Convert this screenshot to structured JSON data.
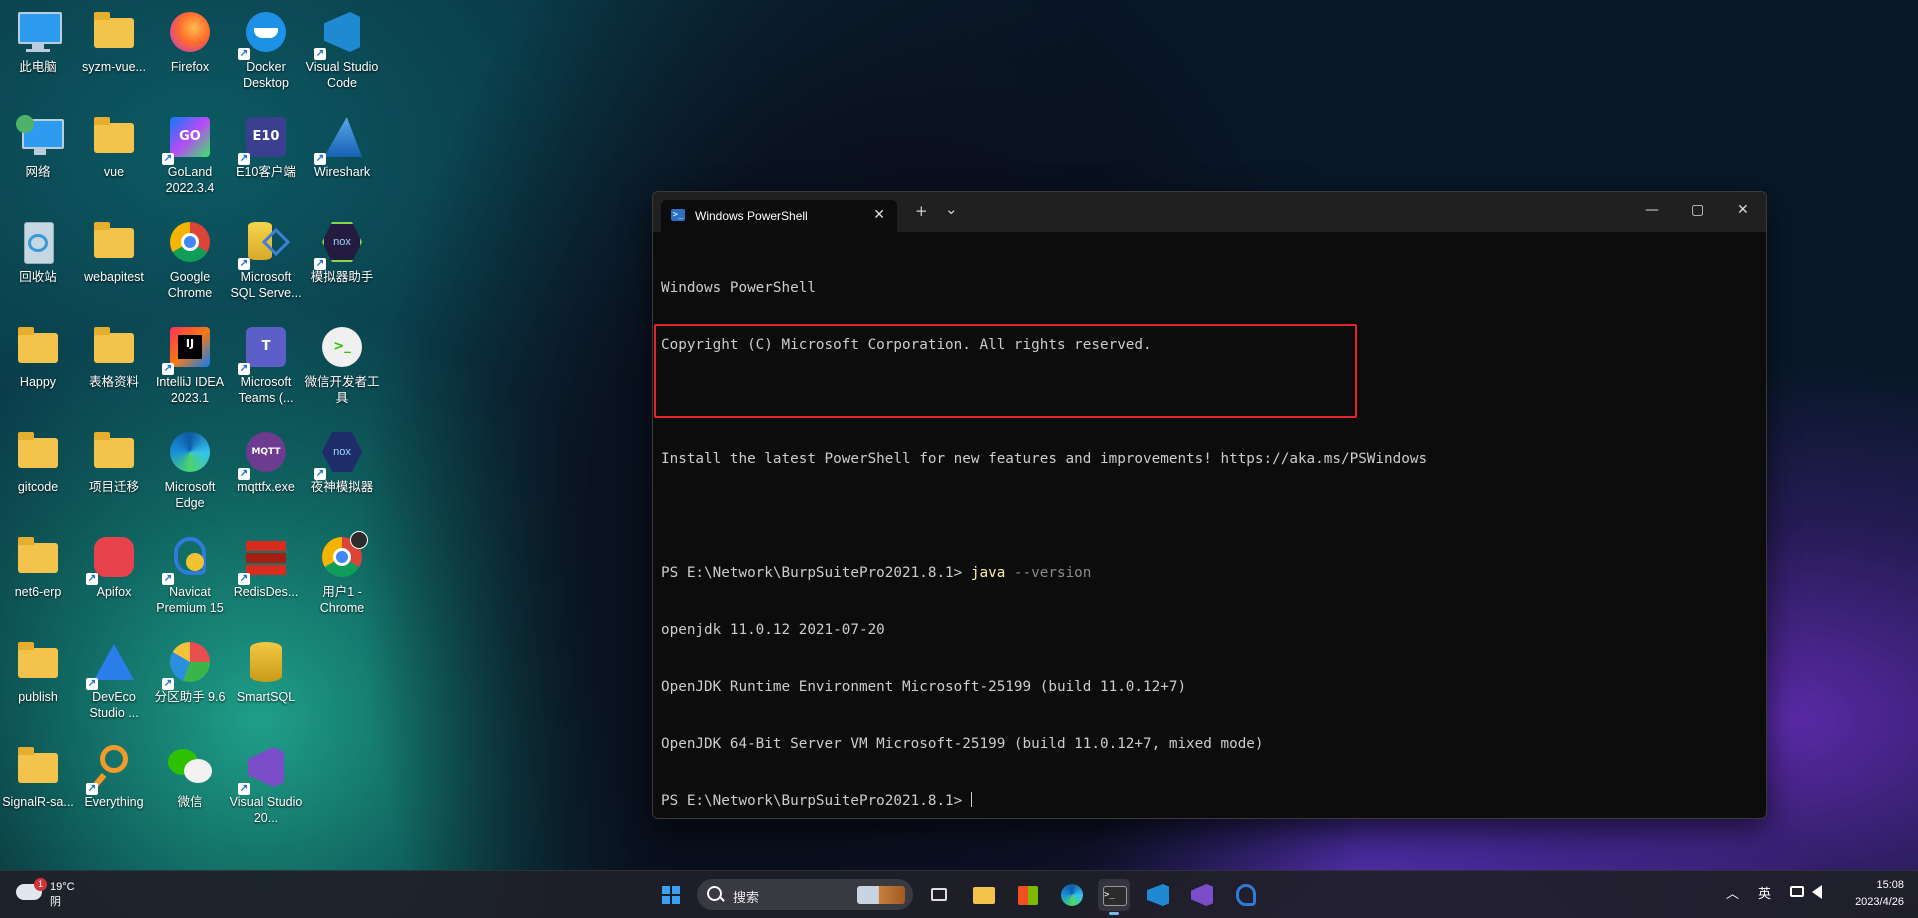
{
  "desktop": {
    "icons": [
      {
        "label": "此电脑"
      },
      {
        "label": "syzm-vue..."
      },
      {
        "label": "Firefox"
      },
      {
        "label": "Docker Desktop"
      },
      {
        "label": "Visual Studio Code"
      },
      {
        "label": "网络"
      },
      {
        "label": "vue"
      },
      {
        "label": "GoLand 2022.3.4"
      },
      {
        "label": "E10客户端"
      },
      {
        "label": "Wireshark"
      },
      {
        "label": "回收站"
      },
      {
        "label": "webapitest"
      },
      {
        "label": "Google Chrome"
      },
      {
        "label": "Microsoft SQL Serve..."
      },
      {
        "label": "模拟器助手"
      },
      {
        "label": "Happy"
      },
      {
        "label": "表格资料"
      },
      {
        "label": "IntelliJ IDEA 2023.1"
      },
      {
        "label": "Microsoft Teams (..."
      },
      {
        "label": "微信开发者工具"
      },
      {
        "label": "gitcode"
      },
      {
        "label": "项目迁移"
      },
      {
        "label": "Microsoft Edge"
      },
      {
        "label": "mqttfx.exe"
      },
      {
        "label": "夜神模拟器"
      },
      {
        "label": "net6-erp"
      },
      {
        "label": "Apifox"
      },
      {
        "label": "Navicat Premium 15"
      },
      {
        "label": "RedisDes..."
      },
      {
        "label": "用户1 - Chrome"
      },
      {
        "label": "publish"
      },
      {
        "label": "DevEco Studio ..."
      },
      {
        "label": "分区助手 9.6"
      },
      {
        "label": "SmartSQL"
      },
      {
        "label": "SignalR-sa..."
      },
      {
        "label": "Everything"
      },
      {
        "label": "微信"
      },
      {
        "label": "Visual Studio 20..."
      }
    ]
  },
  "terminal": {
    "tab_title": "Windows PowerShell",
    "new_tab": "+",
    "dropdown": "⌄",
    "minimize": "—",
    "maximize": "▢",
    "close": "✕",
    "lines": {
      "l1": "Windows PowerShell",
      "l2": "Copyright (C) Microsoft Corporation. All rights reserved.",
      "l3": "",
      "l4": "Install the latest PowerShell for new features and improvements! https://aka.ms/PSWindows",
      "l5": "",
      "prompt": "PS E:\\Network\\BurpSuitePro2021.8.1> ",
      "cmd": "java",
      "arg": " --version",
      "o1": "openjdk 11.0.12 2021-07-20",
      "o2": "OpenJDK Runtime Environment Microsoft-25199 (build 11.0.12+7)",
      "o3": "OpenJDK 64-Bit Server VM Microsoft-25199 (build 11.0.12+7, mixed mode)",
      "prompt2": "PS E:\\Network\\BurpSuitePro2021.8.1> "
    }
  },
  "taskbar": {
    "weather_temp": "19°C",
    "weather_cond": "阴",
    "weather_badge": "1",
    "search_placeholder": "搜索",
    "tray_chevron": "︿",
    "ime": "英",
    "time": "15:08",
    "date": "2023/4/26"
  },
  "colors": {
    "accent": "#3aa0f3",
    "highlight_box": "#e0262c",
    "command": "#f9f1a5"
  }
}
